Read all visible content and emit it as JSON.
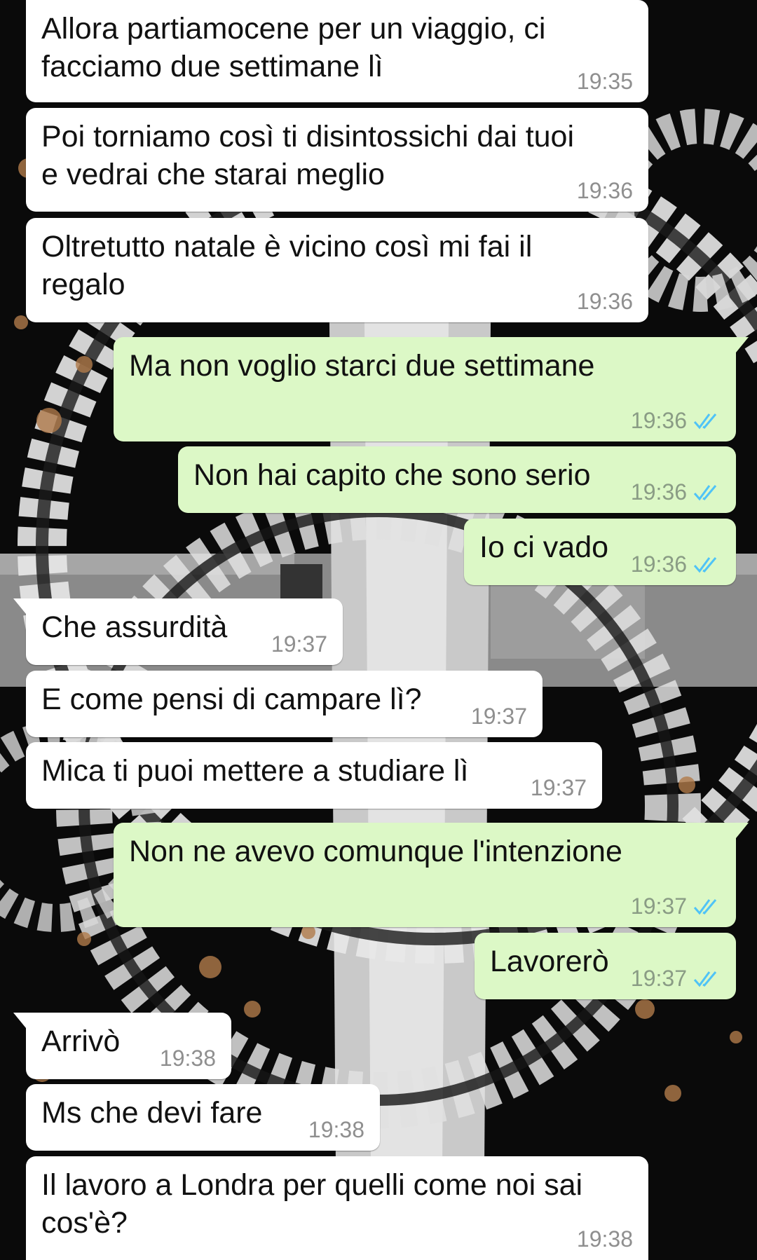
{
  "colors": {
    "incoming_bubble": "#ffffff",
    "outgoing_bubble": "#dcf8c6",
    "read_ticks": "#4fc3f7",
    "timestamp": "#8f8f8f"
  },
  "icons": {
    "read_receipt": "double-check-icon"
  },
  "messages": [
    {
      "direction": "incoming",
      "text_lines": [
        "Allora partiamocene per un viaggio, ci",
        "facciamo due settimane lì"
      ],
      "time": "19:35"
    },
    {
      "direction": "incoming",
      "text_lines": [
        "Poi torniamo così ti disintossichi dai tuoi",
        "e vedrai che starai meglio"
      ],
      "time": "19:36"
    },
    {
      "direction": "incoming",
      "text_lines": [
        "Oltretutto natale è vicino così mi fai il",
        "regalo"
      ],
      "time": "19:36"
    },
    {
      "direction": "outgoing",
      "text_lines": [
        "Ma non voglio starci due settimane"
      ],
      "time": "19:36",
      "read": true
    },
    {
      "direction": "outgoing",
      "text_lines": [
        "Non hai capito che sono serio"
      ],
      "time": "19:36",
      "read": true
    },
    {
      "direction": "outgoing",
      "text_lines": [
        "Io ci vado"
      ],
      "time": "19:36",
      "read": true
    },
    {
      "direction": "incoming",
      "text_lines": [
        "Che assurdità"
      ],
      "time": "19:37"
    },
    {
      "direction": "incoming",
      "text_lines": [
        "E come pensi di campare lì?"
      ],
      "time": "19:37"
    },
    {
      "direction": "incoming",
      "text_lines": [
        "Mica ti puoi mettere a studiare lì"
      ],
      "time": "19:37"
    },
    {
      "direction": "outgoing",
      "text_lines": [
        "Non ne avevo comunque l'intenzione"
      ],
      "time": "19:37",
      "read": true
    },
    {
      "direction": "outgoing",
      "text_lines": [
        "Lavorerò"
      ],
      "time": "19:37",
      "read": true
    },
    {
      "direction": "incoming",
      "text_lines": [
        "Arrivò"
      ],
      "time": "19:38"
    },
    {
      "direction": "incoming",
      "text_lines": [
        "Ms che devi fare"
      ],
      "time": "19:38"
    },
    {
      "direction": "incoming",
      "text_lines": [
        "Il lavoro a Londra per quelli come noi sai",
        "cos'è?"
      ],
      "time": "19:38"
    }
  ]
}
